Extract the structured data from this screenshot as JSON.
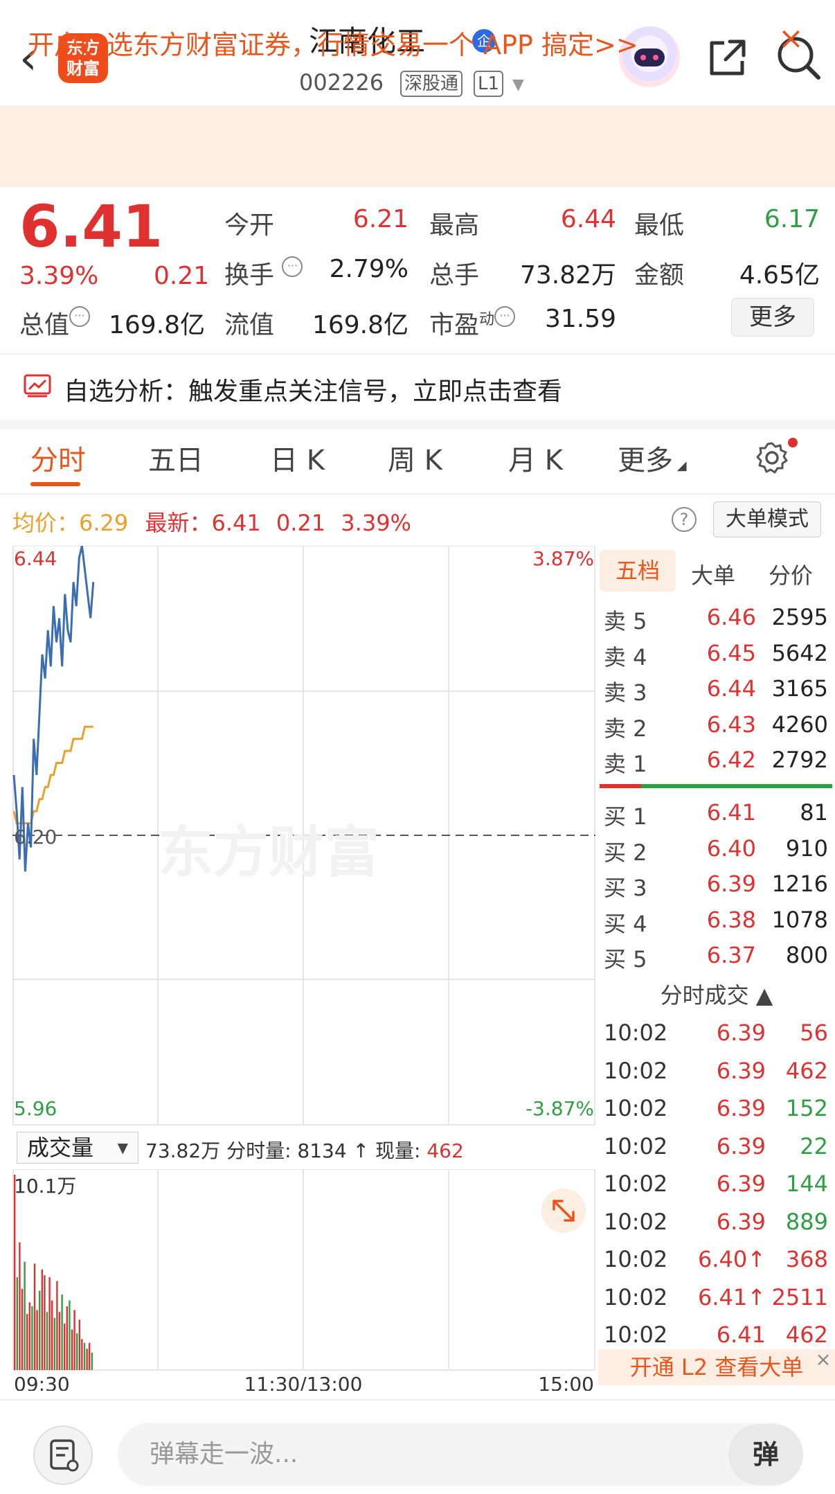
{
  "header": {
    "back_glyph": "‹",
    "logo_text_line1": "东方",
    "logo_text_line2": "财富",
    "title": "江南化工",
    "qi_badge": "企",
    "code": "002226",
    "tag_exchange": "深股通",
    "tag_level": "L1"
  },
  "banner": {
    "text": "开户！选东方财富证券，行情交易一个 APP 搞定>>",
    "close": "×"
  },
  "quote": {
    "price": "6.41",
    "change_pct": "3.39%",
    "change": "0.21",
    "open_label": "今开",
    "open": "6.21",
    "high_label": "最高",
    "high": "6.44",
    "low_label": "最低",
    "low": "6.17",
    "turnover_label": "换手",
    "turnover": "2.79%",
    "volume_label": "总手",
    "volume": "73.82万",
    "amount_label": "金额",
    "amount": "4.65亿",
    "mktcap_label": "总值",
    "mktcap": "169.8亿",
    "float_label": "流值",
    "float": "169.8亿",
    "pe_label": "市盈",
    "pe_sup": "动",
    "pe": "31.59",
    "more_button": "更多"
  },
  "analysis": {
    "text": "自选分析：触发重点关注信号，立即点击查看"
  },
  "tabs": [
    "分时",
    "五日",
    "日 K",
    "周 K",
    "月 K",
    "更多"
  ],
  "avg_bar": {
    "avg_label": "均价：",
    "avg": "6.29",
    "latest_label": "最新：",
    "latest": "6.41",
    "change": "0.21",
    "pct": "3.39%",
    "help": "?",
    "big_order_mode": "大单模式"
  },
  "chart_axes": {
    "y_top": "6.44",
    "y_bottom": "5.96",
    "y_mid": "6.20",
    "pct_top": "3.87%",
    "pct_bottom": "-3.87%",
    "watermark": "东方财富",
    "vol_top": "10.1万",
    "x_labels": [
      "09:30",
      "11:30/13:00",
      "15:00"
    ]
  },
  "chart_data": {
    "type": "line",
    "ylim": [
      5.96,
      6.44
    ],
    "series": [
      {
        "values": [
          6.25,
          6.22,
          6.18,
          6.24,
          6.17,
          6.21,
          6.19,
          6.28,
          6.25,
          6.3,
          6.35,
          6.33,
          6.37,
          6.34,
          6.39,
          6.36,
          6.38,
          6.34,
          6.4,
          6.37,
          6.36,
          6.41,
          6.39,
          6.43,
          6.44,
          6.42,
          6.4,
          6.38,
          6.41
        ]
      },
      {
        "values": [
          6.22,
          6.21,
          6.21,
          6.21,
          6.21,
          6.21,
          6.21,
          6.22,
          6.22,
          6.23,
          6.23,
          6.24,
          6.24,
          6.25,
          6.25,
          6.26,
          6.26,
          6.26,
          6.27,
          6.27,
          6.27,
          6.28,
          6.28,
          6.28,
          6.28,
          6.29,
          6.29,
          6.29,
          6.29
        ]
      }
    ],
    "volume": {
      "values": [
        10.1,
        4.8,
        6.6,
        4.2,
        5.6,
        2.9,
        3.5,
        3.3,
        5.5,
        3.1,
        4.1,
        5.2,
        4.9,
        3.0,
        4.8,
        3.6,
        2.7,
        4.6,
        3.0,
        3.9,
        2.4,
        3.3,
        3.6,
        2.1,
        3.1,
        1.9,
        2.6,
        1.6,
        1.4,
        1.1,
        1.4,
        0.9
      ],
      "ylim": [
        0,
        10.1
      ]
    }
  },
  "volume_bar": {
    "select_label": "成交量",
    "total": "73.82万",
    "minute_label": "分时量:",
    "minute_value": "8134",
    "arrow": "↑",
    "current_label": "现量:",
    "current_value": "462"
  },
  "orderbook": {
    "tabs": [
      "五档",
      "大单",
      "分价"
    ],
    "asks": [
      {
        "label": "卖 5",
        "price": "6.46",
        "vol": "2595"
      },
      {
        "label": "卖 4",
        "price": "6.45",
        "vol": "5642"
      },
      {
        "label": "卖 3",
        "price": "6.44",
        "vol": "3165"
      },
      {
        "label": "卖 2",
        "price": "6.43",
        "vol": "4260"
      },
      {
        "label": "卖 1",
        "price": "6.42",
        "vol": "2792"
      }
    ],
    "bids": [
      {
        "label": "买 1",
        "price": "6.41",
        "vol": "81"
      },
      {
        "label": "买 2",
        "price": "6.40",
        "vol": "910"
      },
      {
        "label": "买 3",
        "price": "6.39",
        "vol": "1216"
      },
      {
        "label": "买 4",
        "price": "6.38",
        "vol": "1078"
      },
      {
        "label": "买 5",
        "price": "6.37",
        "vol": "800"
      }
    ],
    "trades_title": "分时成交 ▲",
    "trades": [
      {
        "time": "10:02",
        "price": "6.39",
        "vol": "56",
        "dir": "sell"
      },
      {
        "time": "10:02",
        "price": "6.39",
        "vol": "462",
        "dir": "sell"
      },
      {
        "time": "10:02",
        "price": "6.39",
        "vol": "152",
        "dir": "buy"
      },
      {
        "time": "10:02",
        "price": "6.39",
        "vol": "22",
        "dir": "buy"
      },
      {
        "time": "10:02",
        "price": "6.39",
        "vol": "144",
        "dir": "buy"
      },
      {
        "time": "10:02",
        "price": "6.39",
        "vol": "889",
        "dir": "buy"
      },
      {
        "time": "10:02",
        "price": "6.40↑",
        "vol": "368",
        "dir": "sell"
      },
      {
        "time": "10:02",
        "price": "6.41↑",
        "vol": "2511",
        "dir": "sell"
      },
      {
        "time": "10:02",
        "price": "6.41",
        "vol": "462",
        "dir": "sell"
      }
    ],
    "l2_button": "开通 L2 查看大单",
    "l2_close": "×"
  },
  "bottom": {
    "danmu_placeholder": "弹幕走一波...",
    "danmu_button": "弹"
  },
  "colors": {
    "red": "#e03131",
    "green": "#2f9e44",
    "accent": "#e8561c",
    "price_line": "#3b6db3",
    "avg_line": "#e8a22c"
  }
}
